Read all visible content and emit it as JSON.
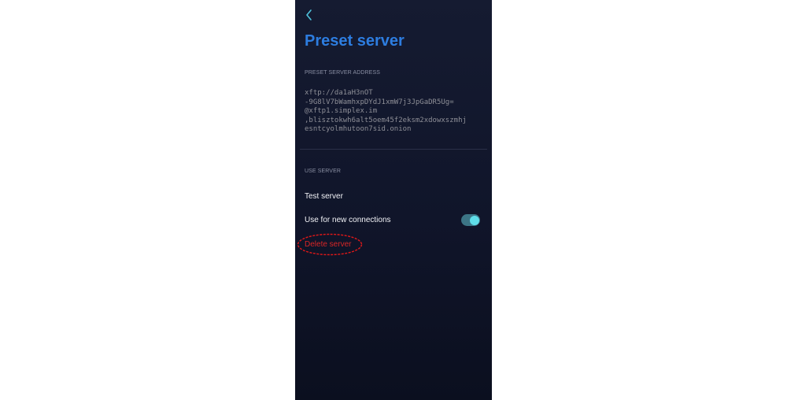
{
  "header": {
    "back_icon": "chevron-left-icon",
    "title": "Preset server"
  },
  "address_section": {
    "label": "PRESET SERVER ADDRESS",
    "address_lines": [
      "xftp://da1aH3nOT",
      "-9G8lV7bWamhxpDYdJ1xmW7j3JpGaDR5Ug=",
      "@xftp1.simplex.im",
      ",blisztokwh6alt5oem45f2eksm2xdowxszmhj",
      "esntcyolmhutoon7sid.onion"
    ]
  },
  "use_section": {
    "label": "USE SERVER",
    "test_server_label": "Test server",
    "use_for_new_label": "Use for new connections",
    "use_for_new_enabled": true,
    "delete_server_label": "Delete server"
  },
  "colors": {
    "accent_title": "#2d7de0",
    "toggle_on": "#5fdde9",
    "danger": "#d92626",
    "annotation": "#e01818"
  }
}
